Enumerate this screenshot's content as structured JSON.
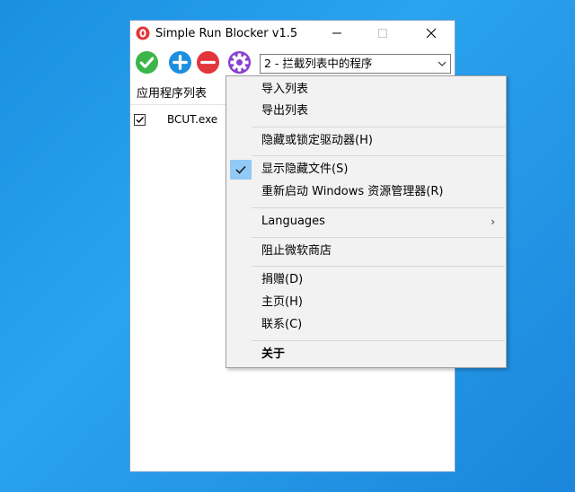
{
  "window": {
    "title": "Simple Run Blocker v1.5"
  },
  "toolbar": {
    "combo_value": "2 - 拦截列表中的程序",
    "icons": [
      "check-icon",
      "add-icon",
      "remove-icon",
      "settings-icon"
    ]
  },
  "list": {
    "header": "应用程序列表",
    "items": [
      {
        "name": "BCUT.exe",
        "checked": true
      }
    ]
  },
  "menu": {
    "items": [
      {
        "label": "导入列表"
      },
      {
        "label": "导出列表"
      },
      {
        "label": "隐藏或锁定驱动器(H)"
      },
      {
        "label": "显示隐藏文件(S)",
        "checked": true
      },
      {
        "label": "重新启动 Windows 资源管理器(R)"
      },
      {
        "label": "Languages",
        "submenu": true
      },
      {
        "label": "阻止微软商店"
      },
      {
        "label": "捐赠(D)"
      },
      {
        "label": "主页(H)"
      },
      {
        "label": "联系(C)"
      },
      {
        "label": "关于",
        "bold": true
      }
    ]
  },
  "colors": {
    "desktop": "#1a8fe0",
    "check_green": "#3cb64a",
    "add_blue": "#1e8fe0",
    "remove_red": "#e2363a",
    "settings_purple": "#8a3fcf",
    "menu_check_highlight": "#91c9f7"
  }
}
